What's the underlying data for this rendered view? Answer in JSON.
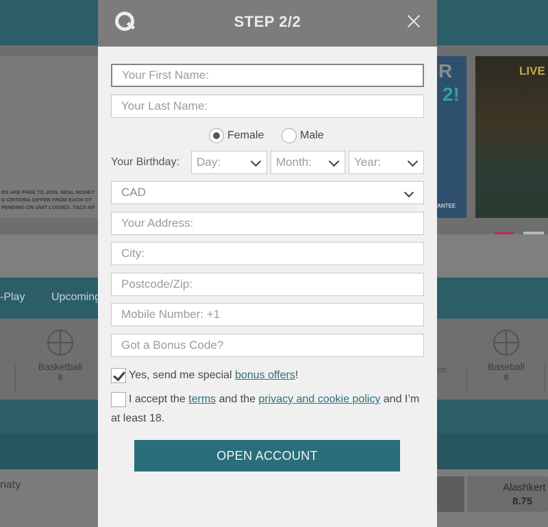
{
  "background": {
    "promo_left_fine": [
      "DS ARE FREE TO JOIN. REAL MONEY",
      "D CRITERIA DIFFER FROM EACH OT",
      "PENDING ON UNIT LOSSES. T&CS AP"
    ],
    "promo_right": {
      "badge": "R",
      "accent": "2!",
      "fine": "ANTEE"
    },
    "promo_live": {
      "label": "LIVE"
    },
    "nav": [
      {
        "label": "-Play"
      },
      {
        "label": "Upcoming"
      }
    ],
    "sports": [
      {
        "label": "Basketball",
        "count": "8",
        "icon": "basketball-icon"
      },
      {
        "label": "Baseball",
        "count": "8",
        "icon": "baseball-icon"
      }
    ],
    "sports_fragment": "on",
    "match": {
      "team": "naty",
      "odds_name": "Alashkert",
      "odds_value": "8.75"
    }
  },
  "modal": {
    "title": "STEP 2/2",
    "logo_icon": "brand-logo-icon",
    "close_icon": "close-icon",
    "fields": {
      "first_name": {
        "placeholder": "Your First Name:",
        "value": ""
      },
      "last_name": {
        "placeholder": "Your Last Name:",
        "value": ""
      },
      "address": {
        "placeholder": "Your Address:",
        "value": ""
      },
      "city": {
        "placeholder": "City:",
        "value": ""
      },
      "postcode": {
        "placeholder": "Postcode/Zip:",
        "value": ""
      },
      "mobile": {
        "placeholder": "Mobile Number: +1",
        "value": ""
      },
      "bonus_code": {
        "placeholder": "Got a Bonus Code?",
        "value": ""
      }
    },
    "gender": {
      "options": [
        "Female",
        "Male"
      ],
      "selected": "Female"
    },
    "birthday": {
      "label": "Your Birthday:",
      "day": "Day:",
      "month": "Month:",
      "year": "Year:"
    },
    "currency": "CAD",
    "bonus_offers": {
      "checked": true,
      "text": "Yes, send me special ",
      "link": "bonus offers",
      "suffix": "!"
    },
    "terms": {
      "checked": false,
      "text1": "I accept the ",
      "link1": "terms",
      "text2": " and the ",
      "link2": "privacy and cookie policy",
      "text3": " and I’m at least 18."
    },
    "submit_label": "OPEN ACCOUNT"
  },
  "colors": {
    "accent": "#2a6e7c",
    "header": "#7c7c7c",
    "carousel_active": "#b0336a"
  }
}
